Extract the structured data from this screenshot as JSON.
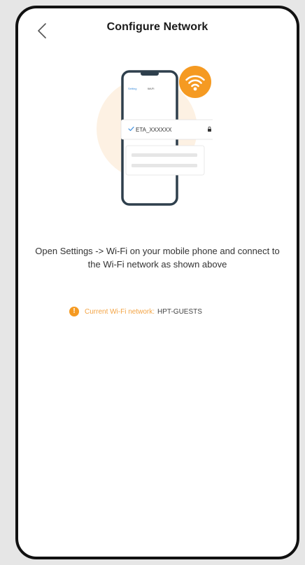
{
  "header": {
    "title": "Configure Network",
    "back_icon": "chevron-left-icon"
  },
  "illustration": {
    "phone_status_left": "Setting",
    "phone_status_title": "Wi-Fi",
    "selected_network": "ETA_XXXXXX",
    "badge_icon": "wifi-icon",
    "colors": {
      "accent": "#f59a22",
      "glow": "#fdf1e3",
      "phone_outline": "#2e3f4c",
      "selected_check": "#3c8ddc"
    }
  },
  "instruction": {
    "text": "Open Settings -> Wi-Fi on your mobile phone and connect to the Wi-Fi network as shown above"
  },
  "current_network": {
    "icon": "warning-icon",
    "label": "Current Wi-Fi network:",
    "value": "HPT-GUESTS"
  }
}
